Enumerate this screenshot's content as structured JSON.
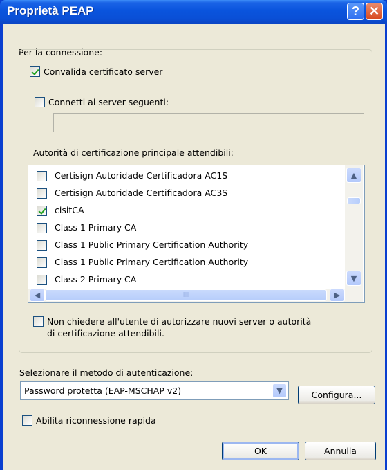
{
  "window": {
    "title": "Proprietà PEAP",
    "help_glyph": "?",
    "close_glyph": "✕"
  },
  "connection_label": "Per la connessione:",
  "validate_cert": {
    "label": "Convalida certificato server",
    "checked": true
  },
  "connect_servers": {
    "label": "Connetti ai server seguenti:",
    "checked": false,
    "value": ""
  },
  "trusted_ca_label": "Autorità di certificazione principale attendibili:",
  "ca_list": [
    {
      "label": "Certisign Autoridade Certificadora AC1S",
      "checked": false
    },
    {
      "label": "Certisign Autoridade Certificadora AC3S",
      "checked": false
    },
    {
      "label": "cisitCA",
      "checked": true
    },
    {
      "label": "Class 1 Primary CA",
      "checked": false
    },
    {
      "label": "Class 1 Public Primary Certification Authority",
      "checked": false
    },
    {
      "label": "Class 1 Public Primary Certification Authority",
      "checked": false
    },
    {
      "label": "Class 2 Primary CA",
      "checked": false
    }
  ],
  "no_prompt": {
    "line1": "Non chiedere all'utente di autorizzare nuovi server o autorità",
    "line2": "di certificazione attendibili.",
    "checked": false
  },
  "auth_method_label": "Selezionare il metodo di autenticazione:",
  "auth_method_value": "Password protetta (EAP-MSCHAP v2)",
  "configure_label": "Configura...",
  "fast_reconnect": {
    "label": "Abilita riconnessione rapida",
    "checked": false
  },
  "ok_label": "OK",
  "cancel_label": "Annulla",
  "icons": {
    "scroll_up": "▲",
    "scroll_down": "▼",
    "scroll_left": "◀",
    "scroll_right": "▶",
    "combo_arrow": "▼",
    "grip": "III"
  }
}
